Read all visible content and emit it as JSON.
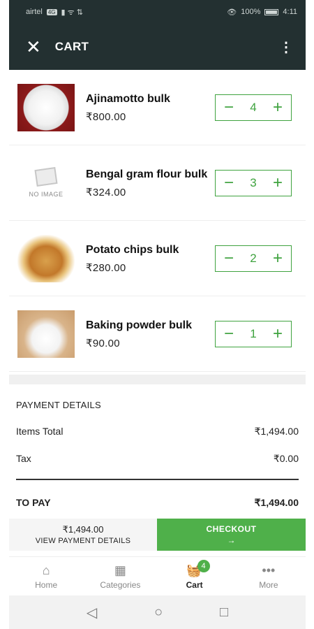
{
  "status_bar": {
    "carrier": "airtel",
    "carrier_badge": "4G",
    "network_icons": "▮ ᯤ ⇅",
    "eye_icon": "👁",
    "battery_text": "100%",
    "time": "4:11"
  },
  "appbar": {
    "close_icon": "✕",
    "title": "CART",
    "menu_icon": "⋮"
  },
  "cart": {
    "items": [
      {
        "name": "Ajinamotto bulk",
        "price": "₹800.00",
        "qty": "4",
        "image": "salt-image"
      },
      {
        "name": "Bengal gram flour bulk",
        "price": "₹324.00",
        "qty": "3",
        "image": "no-image"
      },
      {
        "name": "Potato chips bulk",
        "price": "₹280.00",
        "qty": "2",
        "image": "chips-image"
      },
      {
        "name": "Baking powder bulk",
        "price": "₹90.00",
        "qty": "1",
        "image": "powder-image"
      }
    ],
    "no_image_text": "NO IMAGE",
    "minus_glyph": "−",
    "plus_glyph": "+"
  },
  "payment": {
    "heading": "PAYMENT DETAILS",
    "items_total_label": "Items Total",
    "items_total_value": "₹1,494.00",
    "tax_label": "Tax",
    "tax_value": "₹0.00",
    "to_pay_label": "TO PAY",
    "to_pay_value": "₹1,494.00"
  },
  "checkout_bar": {
    "amount": "₹1,494.00",
    "view_details": "VIEW PAYMENT DETAILS",
    "checkout_label": "CHECKOUT",
    "arrow": "→"
  },
  "bottom_nav": {
    "items": [
      {
        "label": "Home",
        "icon": "⌂"
      },
      {
        "label": "Categories",
        "icon": "▦"
      },
      {
        "label": "Cart",
        "icon": "🧺",
        "badge": "4"
      },
      {
        "label": "More",
        "icon": "•••"
      }
    ]
  },
  "system_nav": {
    "back": "◁",
    "home": "○",
    "recents": "□"
  },
  "colors": {
    "header": "#233031",
    "accent": "#4fb04a"
  }
}
